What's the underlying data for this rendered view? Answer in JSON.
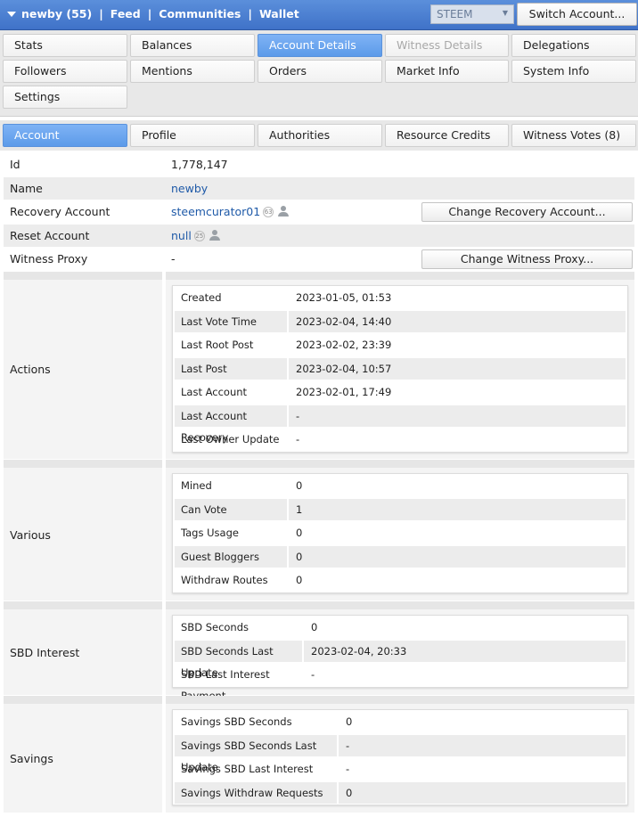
{
  "topbar": {
    "account": "newby (55)",
    "nav": [
      "Feed",
      "Communities",
      "Wallet"
    ],
    "chain": "STEEM",
    "switch_label": "Switch Account..."
  },
  "main_tabs": [
    {
      "label": "Stats"
    },
    {
      "label": "Balances"
    },
    {
      "label": "Account Details"
    },
    {
      "label": "Witness Details"
    },
    {
      "label": "Delegations"
    },
    {
      "label": "Followers"
    },
    {
      "label": "Mentions"
    },
    {
      "label": "Orders"
    },
    {
      "label": "Market Info"
    },
    {
      "label": "System Info"
    },
    {
      "label": "Settings"
    }
  ],
  "sub_tabs": [
    {
      "label": "Account"
    },
    {
      "label": "Profile"
    },
    {
      "label": "Authorities"
    },
    {
      "label": "Resource Credits"
    },
    {
      "label": "Witness Votes (8)"
    }
  ],
  "account": {
    "id_label": "Id",
    "id_value": "1,778,147",
    "name_label": "Name",
    "name_value": "newby",
    "recovery_label": "Recovery Account",
    "recovery_value": "steemcurator01",
    "recovery_rep": "63",
    "reset_label": "Reset Account",
    "reset_value": "null",
    "reset_rep": "25",
    "proxy_label": "Witness Proxy",
    "proxy_value": "-",
    "change_recovery_btn": "Change Recovery Account...",
    "change_proxy_btn": "Change Witness Proxy..."
  },
  "actions": {
    "title": "Actions",
    "rows": [
      {
        "k": "Created",
        "v": "2023-01-05, 01:53"
      },
      {
        "k": "Last Vote Time",
        "v": "2023-02-04, 14:40"
      },
      {
        "k": "Last Root Post",
        "v": "2023-02-02, 23:39"
      },
      {
        "k": "Last Post",
        "v": "2023-02-04, 10:57"
      },
      {
        "k": "Last Account Update",
        "v": "2023-02-01, 17:49"
      },
      {
        "k": "Last Account Recovery",
        "v": "-"
      },
      {
        "k": "Last Owner Update",
        "v": "-"
      }
    ]
  },
  "various": {
    "title": "Various",
    "rows": [
      {
        "k": "Mined",
        "v": "0"
      },
      {
        "k": "Can Vote",
        "v": "1"
      },
      {
        "k": "Tags Usage",
        "v": "0"
      },
      {
        "k": "Guest Bloggers",
        "v": "0"
      },
      {
        "k": "Withdraw Routes",
        "v": "0"
      }
    ]
  },
  "sbd": {
    "title": "SBD Interest",
    "rows": [
      {
        "k": "SBD Seconds",
        "v": "0"
      },
      {
        "k": "SBD Seconds Last Update",
        "v": "2023-02-04, 20:33"
      },
      {
        "k": "SBD Last Interest Payment",
        "v": "-"
      }
    ]
  },
  "savings": {
    "title": "Savings",
    "rows": [
      {
        "k": "Savings SBD Seconds",
        "v": "0"
      },
      {
        "k": "Savings SBD Seconds Last Update",
        "v": "-"
      },
      {
        "k": "Savings SBD Last Interest Payment",
        "v": "-"
      },
      {
        "k": "Savings Withdraw Requests",
        "v": "0"
      }
    ]
  }
}
